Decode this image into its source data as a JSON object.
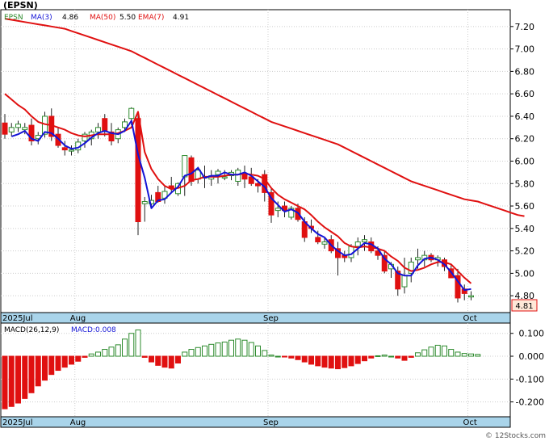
{
  "colors": {
    "up_candle": "#2e8b2e",
    "down_candle": "#e01010",
    "ma3": "#1414d6",
    "ma50": "#e01010",
    "ema7": "#e01010",
    "macd_pos": "#2e8b2e",
    "macd_neg": "#e01010",
    "axis_strip": "#a9d4ea",
    "last_price_box": "#ffe8d8"
  },
  "legend": {
    "symbol": "(EPSN)",
    "sym_short": "EPSN",
    "ma3_label": "MA(3)",
    "ma3_value": "4.86",
    "ma50_label": "MA(50)",
    "ma50_value": "5.50",
    "ema7_label": "EMA(7)",
    "ema7_value": "4.91"
  },
  "macd_legend": {
    "label": "MACD(26,12,9)",
    "value_label": "MACD:0.008"
  },
  "last_price": "4.81",
  "footer": "© 12Stocks.com",
  "chart_data": [
    {
      "type": "candlestick",
      "title": "(EPSN)",
      "ylim": [
        4.65,
        7.35
      ],
      "y_ticks": [
        4.8,
        5.0,
        5.2,
        5.4,
        5.6,
        5.8,
        6.0,
        6.2,
        6.4,
        6.6,
        6.8,
        7.0,
        7.2
      ],
      "y_tick_labels": [
        "4.80",
        "5.00",
        "5.20",
        "5.40",
        "5.60",
        "5.80",
        "6.00",
        "6.20",
        "6.40",
        "6.60",
        "6.80",
        "7.00",
        "7.20"
      ],
      "x_tick_labels": [
        {
          "label": "2025Jul",
          "index": 0
        },
        {
          "label": "Aug",
          "index": 11
        },
        {
          "label": "Sep",
          "index": 40
        },
        {
          "label": "Oct",
          "index": 70
        }
      ],
      "candles": [
        [
          6.34,
          6.42,
          6.2,
          6.24
        ],
        [
          6.26,
          6.34,
          6.22,
          6.3
        ],
        [
          6.3,
          6.36,
          6.26,
          6.33
        ],
        [
          6.28,
          6.34,
          6.24,
          6.3
        ],
        [
          6.32,
          6.38,
          6.14,
          6.18
        ],
        [
          6.2,
          6.26,
          6.15,
          6.23
        ],
        [
          6.24,
          6.44,
          6.21,
          6.4
        ],
        [
          6.4,
          6.47,
          6.18,
          6.22
        ],
        [
          6.24,
          6.3,
          6.12,
          6.14
        ],
        [
          6.12,
          6.18,
          6.05,
          6.1
        ],
        [
          6.09,
          6.14,
          6.05,
          6.1
        ],
        [
          6.1,
          6.2,
          6.07,
          6.17
        ],
        [
          6.18,
          6.26,
          6.12,
          6.24
        ],
        [
          6.2,
          6.28,
          6.14,
          6.26
        ],
        [
          6.26,
          6.34,
          6.2,
          6.3
        ],
        [
          6.38,
          6.42,
          6.22,
          6.27
        ],
        [
          6.26,
          6.34,
          6.14,
          6.18
        ],
        [
          6.2,
          6.3,
          6.16,
          6.28
        ],
        [
          6.3,
          6.38,
          6.26,
          6.35
        ],
        [
          6.38,
          6.48,
          6.32,
          6.47
        ],
        [
          6.38,
          6.42,
          5.34,
          5.46
        ],
        [
          5.62,
          5.68,
          5.46,
          5.64
        ],
        [
          5.62,
          5.7,
          5.58,
          5.65
        ],
        [
          5.72,
          5.78,
          5.63,
          5.64
        ],
        [
          5.67,
          5.78,
          5.62,
          5.73
        ],
        [
          5.78,
          5.86,
          5.72,
          5.76
        ],
        [
          5.71,
          5.81,
          5.69,
          5.8
        ],
        [
          5.86,
          6.05,
          5.69,
          6.05
        ],
        [
          6.03,
          6.05,
          5.78,
          5.82
        ],
        [
          5.84,
          5.95,
          5.8,
          5.92
        ],
        [
          5.86,
          5.96,
          5.76,
          5.86
        ],
        [
          5.84,
          5.92,
          5.78,
          5.87
        ],
        [
          5.88,
          5.93,
          5.8,
          5.91
        ],
        [
          5.85,
          5.92,
          5.83,
          5.86
        ],
        [
          5.87,
          5.92,
          5.83,
          5.9
        ],
        [
          5.82,
          5.94,
          5.78,
          5.92
        ],
        [
          5.88,
          5.96,
          5.76,
          5.84
        ],
        [
          5.86,
          5.94,
          5.78,
          5.8
        ],
        [
          5.8,
          5.84,
          5.72,
          5.78
        ],
        [
          5.88,
          5.92,
          5.64,
          5.72
        ],
        [
          5.72,
          5.76,
          5.45,
          5.52
        ],
        [
          5.56,
          5.64,
          5.5,
          5.58
        ],
        [
          5.6,
          5.64,
          5.5,
          5.56
        ],
        [
          5.5,
          5.6,
          5.48,
          5.58
        ],
        [
          5.58,
          5.62,
          5.46,
          5.48
        ],
        [
          5.46,
          5.5,
          5.28,
          5.32
        ],
        [
          5.42,
          5.48,
          5.36,
          5.4
        ],
        [
          5.32,
          5.38,
          5.26,
          5.28
        ],
        [
          5.26,
          5.32,
          5.22,
          5.28
        ],
        [
          5.3,
          5.34,
          5.18,
          5.2
        ],
        [
          5.22,
          5.28,
          4.98,
          5.14
        ],
        [
          5.16,
          5.2,
          5.1,
          5.14
        ],
        [
          5.14,
          5.26,
          5.1,
          5.24
        ],
        [
          5.24,
          5.32,
          5.16,
          5.28
        ],
        [
          5.28,
          5.34,
          5.2,
          5.3
        ],
        [
          5.28,
          5.32,
          5.18,
          5.2
        ],
        [
          5.2,
          5.24,
          5.12,
          5.16
        ],
        [
          5.16,
          5.2,
          5.0,
          5.02
        ],
        [
          5.04,
          5.1,
          4.96,
          5.08
        ],
        [
          5.02,
          5.06,
          4.8,
          4.86
        ],
        [
          4.88,
          5.14,
          4.82,
          4.98
        ],
        [
          5.0,
          5.14,
          4.92,
          5.1
        ],
        [
          5.12,
          5.22,
          5.04,
          5.14
        ],
        [
          5.12,
          5.2,
          5.06,
          5.16
        ],
        [
          5.16,
          5.18,
          5.1,
          5.12
        ],
        [
          5.12,
          5.16,
          5.06,
          5.14
        ],
        [
          5.12,
          5.14,
          5.02,
          5.06
        ],
        [
          5.04,
          5.08,
          4.96,
          4.96
        ],
        [
          4.98,
          5.04,
          4.74,
          4.78
        ],
        [
          4.86,
          4.9,
          4.76,
          4.82
        ],
        [
          4.8,
          4.84,
          4.76,
          4.8
        ]
      ],
      "series": [
        {
          "name": "MA(50)",
          "values": [
            7.27,
            7.26,
            7.25,
            7.24,
            7.23,
            7.22,
            7.21,
            7.2,
            7.19,
            7.18,
            7.16,
            7.14,
            7.12,
            7.1,
            7.08,
            7.06,
            7.04,
            7.02,
            7.0,
            6.98,
            6.95,
            6.92,
            6.89,
            6.86,
            6.83,
            6.8,
            6.77,
            6.74,
            6.71,
            6.68,
            6.65,
            6.62,
            6.59,
            6.56,
            6.53,
            6.5,
            6.47,
            6.44,
            6.41,
            6.38,
            6.35,
            6.33,
            6.31,
            6.29,
            6.27,
            6.25,
            6.23,
            6.21,
            6.19,
            6.17,
            6.15,
            6.12,
            6.09,
            6.06,
            6.03,
            6.0,
            5.97,
            5.94,
            5.91,
            5.88,
            5.85,
            5.82,
            5.8,
            5.78,
            5.76,
            5.74,
            5.72,
            5.7,
            5.68,
            5.66,
            5.65,
            5.64,
            5.62,
            5.6,
            5.58,
            5.56,
            5.54,
            5.52,
            5.51
          ]
        },
        {
          "name": "EMA(7)",
          "values": [
            6.6,
            6.55,
            6.5,
            6.46,
            6.4,
            6.35,
            6.33,
            6.32,
            6.3,
            6.28,
            6.25,
            6.23,
            6.22,
            6.23,
            6.24,
            6.24,
            6.24,
            6.25,
            6.27,
            6.3,
            6.44,
            6.08,
            5.93,
            5.84,
            5.78,
            5.75,
            5.76,
            5.78,
            5.83,
            5.84,
            5.86,
            5.86,
            5.86,
            5.87,
            5.88,
            5.88,
            5.89,
            5.88,
            5.87,
            5.84,
            5.76,
            5.7,
            5.66,
            5.63,
            5.6,
            5.57,
            5.52,
            5.46,
            5.41,
            5.37,
            5.33,
            5.27,
            5.24,
            5.23,
            5.24,
            5.23,
            5.22,
            5.2,
            5.15,
            5.11,
            5.05,
            5.02,
            5.03,
            5.05,
            5.08,
            5.1,
            5.1,
            5.08,
            5.02,
            4.96,
            4.91
          ]
        },
        {
          "name": "MA(3)",
          "start_index": 1,
          "values": [
            6.22,
            6.24,
            6.27,
            6.2,
            6.18,
            6.26,
            6.25,
            6.2,
            6.14,
            6.11,
            6.12,
            6.16,
            6.21,
            6.25,
            6.27,
            6.25,
            6.24,
            6.27,
            6.36,
            6.06,
            5.85,
            5.58,
            5.65,
            5.66,
            5.72,
            5.77,
            5.87,
            5.89,
            5.94,
            5.85,
            5.87,
            5.87,
            5.9,
            5.88,
            5.88,
            5.9,
            5.87,
            5.82,
            5.77,
            5.67,
            5.61,
            5.55,
            5.57,
            5.54,
            5.46,
            5.4,
            5.35,
            5.32,
            5.25,
            5.2,
            5.16,
            5.17,
            5.22,
            5.27,
            5.26,
            5.22,
            5.13,
            5.08,
            5.0,
            4.98,
            4.98,
            5.07,
            5.13,
            5.14,
            5.12,
            5.08,
            5.01,
            4.93,
            4.85,
            4.86
          ]
        }
      ]
    },
    {
      "type": "bar",
      "title": "MACD(26,12,9)",
      "ylim": [
        -0.265,
        0.145
      ],
      "y_ticks": [
        0.1,
        0.0,
        -0.1,
        -0.2
      ],
      "y_tick_labels": [
        "0.100",
        "0.000",
        "-0.100",
        "-0.200"
      ],
      "values": [
        -0.23,
        -0.22,
        -0.205,
        -0.185,
        -0.16,
        -0.13,
        -0.105,
        -0.08,
        -0.062,
        -0.048,
        -0.035,
        -0.022,
        -0.005,
        0.01,
        0.018,
        0.03,
        0.04,
        0.05,
        0.075,
        0.1,
        0.115,
        -0.005,
        -0.025,
        -0.04,
        -0.048,
        -0.052,
        -0.03,
        0.018,
        0.03,
        0.038,
        0.045,
        0.052,
        0.058,
        0.062,
        0.07,
        0.075,
        0.07,
        0.06,
        0.045,
        0.025,
        0.005,
        0.0,
        -0.002,
        -0.008,
        -0.015,
        -0.025,
        -0.035,
        -0.042,
        -0.048,
        -0.052,
        -0.055,
        -0.05,
        -0.042,
        -0.032,
        -0.02,
        -0.008,
        0.002,
        0.005,
        0.0,
        -0.008,
        -0.018,
        -0.005,
        0.015,
        0.028,
        0.04,
        0.048,
        0.045,
        0.03,
        0.018,
        0.012,
        0.01,
        0.008
      ]
    }
  ]
}
